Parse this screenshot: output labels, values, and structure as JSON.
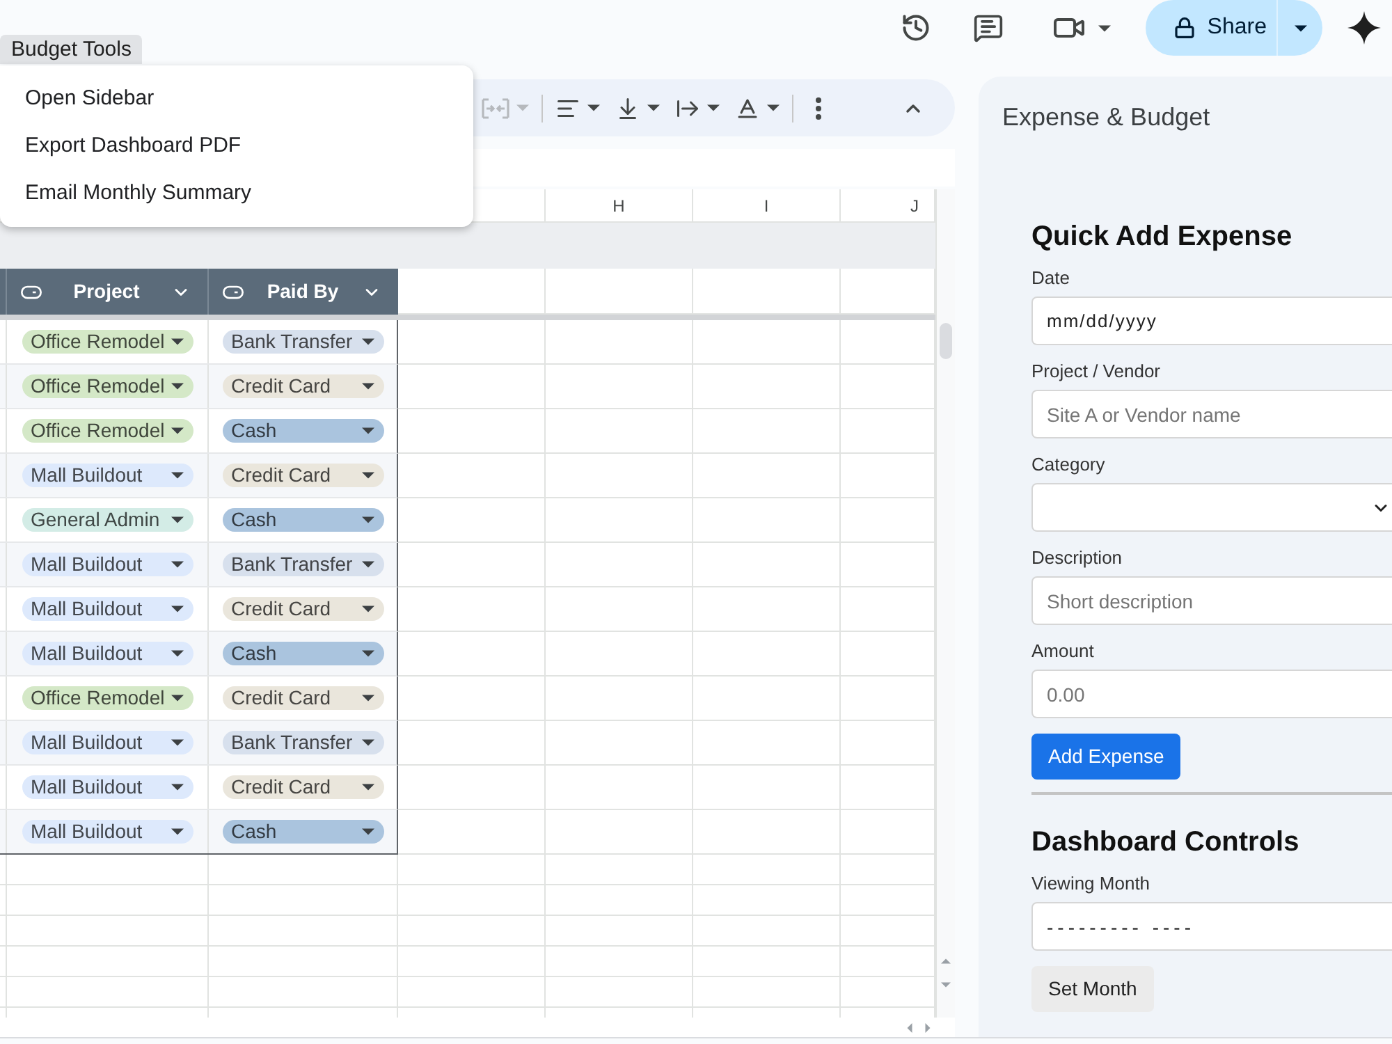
{
  "top_bar": {
    "share_label": "Share"
  },
  "menu": {
    "title": "Budget Tools",
    "open": true,
    "items": [
      "Open Sidebar",
      "Export Dashboard PDF",
      "Email Monthly Summary"
    ]
  },
  "toolbar": {
    "groups": [
      [
        {
          "kind": "merge",
          "disabled": true
        }
      ],
      [
        {
          "kind": "align",
          "disabled": false
        },
        {
          "kind": "valign",
          "disabled": false
        },
        {
          "kind": "wrap",
          "disabled": false
        },
        {
          "kind": "rotate",
          "disabled": false
        }
      ],
      [
        {
          "kind": "more",
          "disabled": false
        }
      ]
    ]
  },
  "sheet": {
    "column_letters": [
      "H",
      "I",
      "J"
    ],
    "table": {
      "columns": [
        {
          "title": "Project"
        },
        {
          "title": "Paid By"
        }
      ],
      "rows": [
        {
          "cells": [
            {
              "label": "Office Remodel",
              "color": "#d4e8c7"
            },
            {
              "label": "Bank Transfer",
              "color": "#d7e0ed"
            }
          ]
        },
        {
          "cells": [
            {
              "label": "Office Remodel",
              "color": "#d4e8c7"
            },
            {
              "label": "Credit Card",
              "color": "#eae6dc"
            }
          ]
        },
        {
          "cells": [
            {
              "label": "Office Remodel",
              "color": "#d4e8c7"
            },
            {
              "label": "Cash",
              "color": "#aac4de"
            }
          ]
        },
        {
          "cells": [
            {
              "label": "Mall Buildout",
              "color": "#dde9fc"
            },
            {
              "label": "Credit Card",
              "color": "#eae6dc"
            }
          ]
        },
        {
          "cells": [
            {
              "label": "General Admin",
              "color": "#d3ece6"
            },
            {
              "label": "Cash",
              "color": "#aac4de"
            }
          ]
        },
        {
          "cells": [
            {
              "label": "Mall Buildout",
              "color": "#dde9fc"
            },
            {
              "label": "Bank Transfer",
              "color": "#d7e0ed"
            }
          ]
        },
        {
          "cells": [
            {
              "label": "Mall Buildout",
              "color": "#dde9fc"
            },
            {
              "label": "Credit Card",
              "color": "#eae6dc"
            }
          ]
        },
        {
          "cells": [
            {
              "label": "Mall Buildout",
              "color": "#dde9fc"
            },
            {
              "label": "Cash",
              "color": "#aac4de"
            }
          ]
        },
        {
          "cells": [
            {
              "label": "Office Remodel",
              "color": "#d4e8c7"
            },
            {
              "label": "Credit Card",
              "color": "#eae6dc"
            }
          ]
        },
        {
          "cells": [
            {
              "label": "Mall Buildout",
              "color": "#dde9fc"
            },
            {
              "label": "Bank Transfer",
              "color": "#d7e0ed"
            }
          ]
        },
        {
          "cells": [
            {
              "label": "Mall Buildout",
              "color": "#dde9fc"
            },
            {
              "label": "Credit Card",
              "color": "#eae6dc"
            }
          ]
        },
        {
          "cells": [
            {
              "label": "Mall Buildout",
              "color": "#dde9fc"
            },
            {
              "label": "Cash",
              "color": "#aac4de"
            }
          ]
        }
      ]
    }
  },
  "sidebar": {
    "title": "Expense & Budget",
    "sections": [
      {
        "heading": "Quick Add Expense",
        "fields": [
          {
            "kind": "date",
            "label": "Date",
            "placeholder": "mm/dd/yyyy"
          },
          {
            "kind": "text",
            "label": "Project / Vendor",
            "placeholder": "Site A or Vendor name"
          },
          {
            "kind": "select",
            "label": "Category"
          },
          {
            "kind": "text",
            "label": "Description",
            "placeholder": "Short description"
          },
          {
            "kind": "number",
            "label": "Amount",
            "placeholder": "0.00"
          }
        ],
        "button": {
          "kind": "primary",
          "label": "Add Expense"
        }
      },
      {
        "heading": "Dashboard Controls",
        "fields": [
          {
            "kind": "month",
            "label": "Viewing Month",
            "placeholder": "--------- ----"
          }
        ],
        "button": {
          "kind": "secondary",
          "label": "Set Month"
        }
      }
    ]
  }
}
